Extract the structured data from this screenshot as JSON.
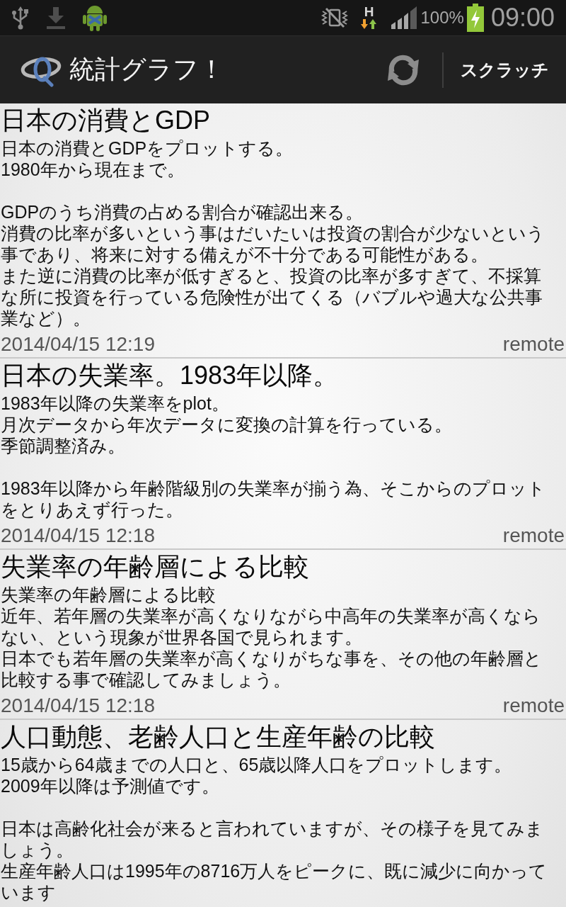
{
  "status_bar": {
    "network_type": "H",
    "battery_text": "100%",
    "time": "09:00"
  },
  "action_bar": {
    "title": "統計グラフ！",
    "action": "スクラッチ"
  },
  "entries": [
    {
      "title": "日本の消費とGDP",
      "paragraphs": [
        {
          "lines": [
            "日本の消費とGDPをプロットする。",
            "1980年から現在まで。"
          ]
        },
        {
          "lines": [
            "GDPのうち消費の占める割合が確認出来る。",
            "消費の比率が多いという事はだいたいは投資の割合が少ないという事であり、将来に対する備えが不十分である可能性がある。",
            "また逆に消費の比率が低すぎると、投資の比率が多すぎて、不採算な所に投資を行っている危険性が出てくる（バブルや過大な公共事業など）。"
          ]
        }
      ],
      "date": "2014/04/15 12:19",
      "source": "remote"
    },
    {
      "title": "日本の失業率。1983年以降。",
      "paragraphs": [
        {
          "lines": [
            "1983年以降の失業率をplot。",
            "月次データから年次データに変換の計算を行っている。",
            "季節調整済み。"
          ]
        },
        {
          "lines": [
            "1983年以降から年齢階級別の失業率が揃う為、そこからのプロットをとりあえず行った。"
          ]
        }
      ],
      "date": "2014/04/15 12:18",
      "source": "remote"
    },
    {
      "title": "失業率の年齢層による比較",
      "paragraphs": [
        {
          "lines": [
            "失業率の年齢層による比較",
            "近年、若年層の失業率が高くなりながら中高年の失業率が高くならない、という現象が世界各国で見られます。",
            "日本でも若年層の失業率が高くなりがちな事を、その他の年齢層と比較する事で確認してみましょう。"
          ]
        }
      ],
      "date": "2014/04/15 12:18",
      "source": "remote"
    },
    {
      "title": "人口動態、老齢人口と生産年齢の比較",
      "paragraphs": [
        {
          "lines": [
            "15歳から64歳までの人口と、65歳以降人口をプロットします。",
            "2009年以降は予測値です。"
          ]
        },
        {
          "lines": [
            "日本は高齢化社会が来ると言われていますが、その様子を見てみましょう。",
            "生産年齢人口は1995年の8716万人をピークに、既に減少に向かっています"
          ]
        }
      ]
    }
  ]
}
